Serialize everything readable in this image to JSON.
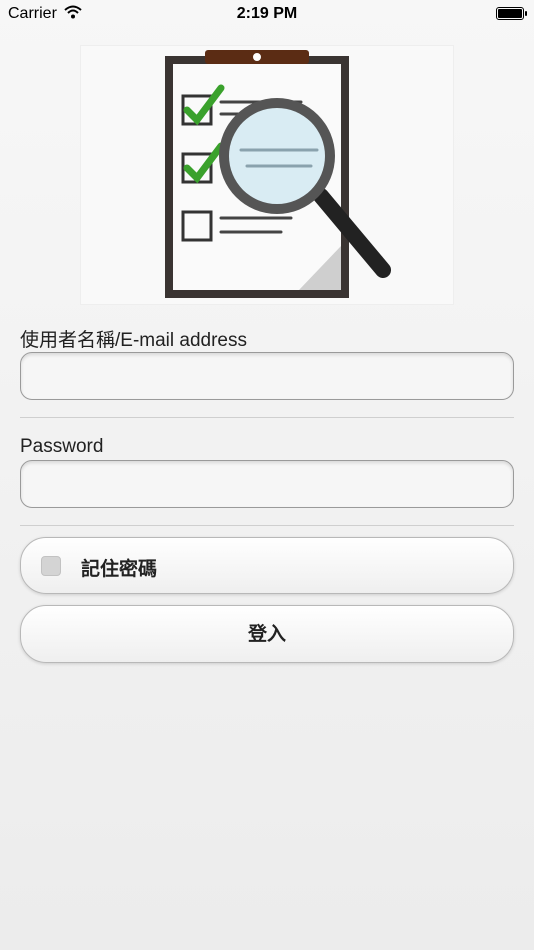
{
  "status_bar": {
    "carrier": "Carrier",
    "time": "2:19 PM"
  },
  "logo": {
    "icon": "clipboard-checklist-magnifier-icon"
  },
  "form": {
    "username_label": "使用者名稱/E-mail address",
    "username_value": "",
    "password_label": "Password",
    "password_value": "",
    "remember_label": "記住密碼",
    "remember_checked": false,
    "login_label": "登入"
  }
}
